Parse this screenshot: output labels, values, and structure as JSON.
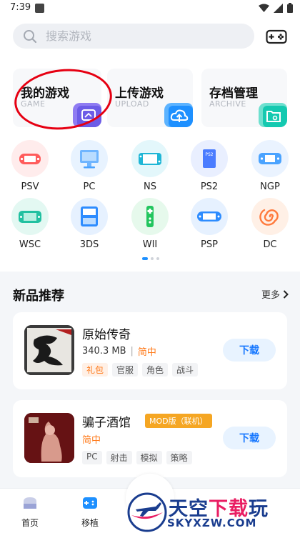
{
  "status": {
    "time": "7:39"
  },
  "search": {
    "placeholder": "搜索游戏",
    "value": ""
  },
  "top_cards": [
    {
      "title": "我的游戏",
      "subtitle": "GAME",
      "icon": "my-games-icon",
      "color": "#6c5ce7"
    },
    {
      "title": "上传游戏",
      "subtitle": "UPLOAD",
      "icon": "upload-cloud-icon",
      "color": "#1e90ff"
    },
    {
      "title": "存档管理",
      "subtitle": "ARCHIVE",
      "icon": "archive-folder-icon",
      "color": "#14c9b0"
    }
  ],
  "platforms": [
    {
      "label": "PSV",
      "icon": "psv-console-icon",
      "color": "#ff5b5b",
      "bg": "#ffecec"
    },
    {
      "label": "PC",
      "icon": "pc-monitor-icon",
      "color": "#4aa3ff",
      "bg": "#e8f3ff"
    },
    {
      "label": "NS",
      "icon": "switch-console-icon",
      "color": "#1fb6d6",
      "bg": "#e3f7fb"
    },
    {
      "label": "PS2",
      "icon": "ps2-console-icon",
      "color": "#4a7cff",
      "bg": "#e9efff"
    },
    {
      "label": "NGP",
      "icon": "ngp-handheld-icon",
      "color": "#4aa3ff",
      "bg": "#eaf3ff"
    },
    {
      "label": "WSC",
      "icon": "wsc-handheld-icon",
      "color": "#21c0a0",
      "bg": "#e3f8f2"
    },
    {
      "label": "3DS",
      "icon": "3ds-handheld-icon",
      "color": "#2d8cff",
      "bg": "#e6f1ff"
    },
    {
      "label": "WII",
      "icon": "wii-remote-icon",
      "color": "#22c55e",
      "bg": "#e6f9ec"
    },
    {
      "label": "PSP",
      "icon": "psp-handheld-icon",
      "color": "#2d8cff",
      "bg": "#e6f1ff"
    },
    {
      "label": "DC",
      "icon": "dreamcast-swirl-icon",
      "color": "#ff7a3d",
      "bg": "#fff0e6"
    }
  ],
  "section": {
    "title": "新品推荐",
    "more": "更多"
  },
  "games": [
    {
      "name": "原始传奇",
      "size": "340.3 MB",
      "lang": "简中",
      "tags": [
        "礼包",
        "官服",
        "角色",
        "战斗"
      ],
      "download": "下载"
    },
    {
      "name": "骗子酒馆",
      "badge": "MOD版（联机）",
      "lang": "简中",
      "tags": [
        "PC",
        "射击",
        "模拟",
        "策略"
      ],
      "download": "下载"
    }
  ],
  "bottom_nav": [
    {
      "label": "首页",
      "icon": "home-icon"
    },
    {
      "label": "移植",
      "icon": "port-gamepad-icon"
    }
  ],
  "watermark": {
    "title_a": "天空",
    "title_b": "下载",
    "title_c": "玩",
    "url": "SKYXZW.COM"
  },
  "colors": {
    "accent": "#1677ff",
    "orange": "#ff7a1a",
    "mark": "#e60012"
  }
}
